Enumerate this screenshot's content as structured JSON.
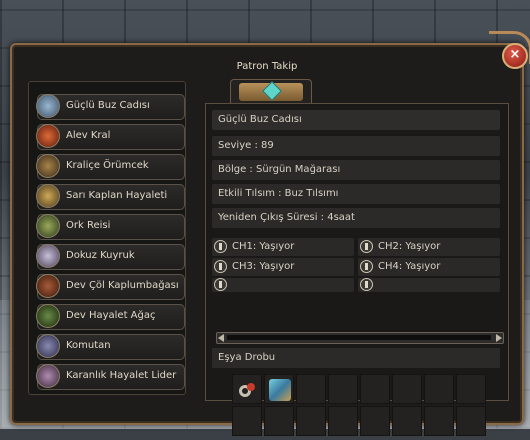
{
  "window": {
    "title": "Patron Takip",
    "close_symbol": "×"
  },
  "boss_list": [
    {
      "label": "Güçlü Buz Cadısı",
      "icon": "ice-witch-icon",
      "color": "#6a8aa8"
    },
    {
      "label": "Alev Kral",
      "icon": "flame-king-icon",
      "color": "#b03a22"
    },
    {
      "label": "Kraliçe Örümcek",
      "icon": "queen-spider-icon",
      "color": "#7a5a3a"
    },
    {
      "label": "Sarı Kaplan Hayaleti",
      "icon": "yellow-tiger-ghost-icon",
      "color": "#a8843a"
    },
    {
      "label": "Ork Reisi",
      "icon": "orc-chief-icon",
      "color": "#6a7a3a"
    },
    {
      "label": "Dokuz Kuyruk",
      "icon": "nine-tails-icon",
      "color": "#8a80a0"
    },
    {
      "label": "Dev Çöl Kaplumbağası",
      "icon": "desert-turtle-icon",
      "color": "#6a3a2a"
    },
    {
      "label": "Dev Hayalet Ağaç",
      "icon": "ghost-tree-icon",
      "color": "#3a5a2a"
    },
    {
      "label": "Komutan",
      "icon": "commander-icon",
      "color": "#4a4a6a"
    },
    {
      "label": "Karanlık Hayalet Lider",
      "icon": "dark-ghost-leader-icon",
      "color": "#7a5a7a"
    }
  ],
  "details": {
    "boss_name": "Güçlü Buz Cadısı",
    "level": "Seviye : 89",
    "region": "Bölge : Sürgün Mağarası",
    "talisman": "Etkili Tılsım : Buz Tılsımı",
    "respawn": "Yeniden Çıkış Süresi : 4saat"
  },
  "channels": [
    {
      "label": "CH1: Yaşıyor"
    },
    {
      "label": "CH2: Yaşıyor"
    },
    {
      "label": "CH3: Yaşıyor"
    },
    {
      "label": "CH4: Yaşıyor"
    },
    {
      "label": ""
    },
    {
      "label": ""
    }
  ],
  "drops": {
    "header": "Eşya Drobu",
    "items": [
      "ring-item-icon",
      "chest-item-icon"
    ]
  }
}
